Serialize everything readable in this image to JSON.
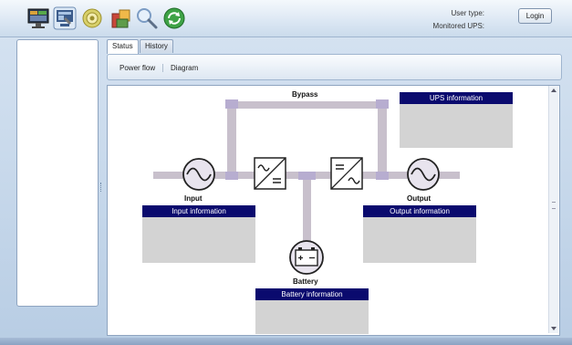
{
  "toolbar": {
    "icons": [
      "monitor-icon",
      "configuration-icon",
      "settings-gear-icon",
      "tools-icon",
      "search-icon",
      "refresh-icon"
    ],
    "user_type_label": "User type:",
    "monitored_ups_label": "Monitored UPS:",
    "login_label": "Login"
  },
  "tabs": [
    {
      "label": "Status",
      "active": true
    },
    {
      "label": "History",
      "active": false
    }
  ],
  "subnav": {
    "power_flow": "Power flow",
    "diagram": "Diagram"
  },
  "diagram": {
    "bypass_label": "Bypass",
    "input_label": "Input",
    "output_label": "Output",
    "battery_label": "Battery",
    "ups_information": "UPS information",
    "input_information": "Input information",
    "output_information": "Output information",
    "battery_information": "Battery information",
    "rectifier_icon": "ac-to-dc-icon",
    "inverter_icon": "dc-to-ac-icon",
    "colors": {
      "info_header": "#0a0a6e",
      "info_body": "#d3d3d3",
      "line": "#c8c0cc",
      "junction": "#b7add0"
    }
  }
}
